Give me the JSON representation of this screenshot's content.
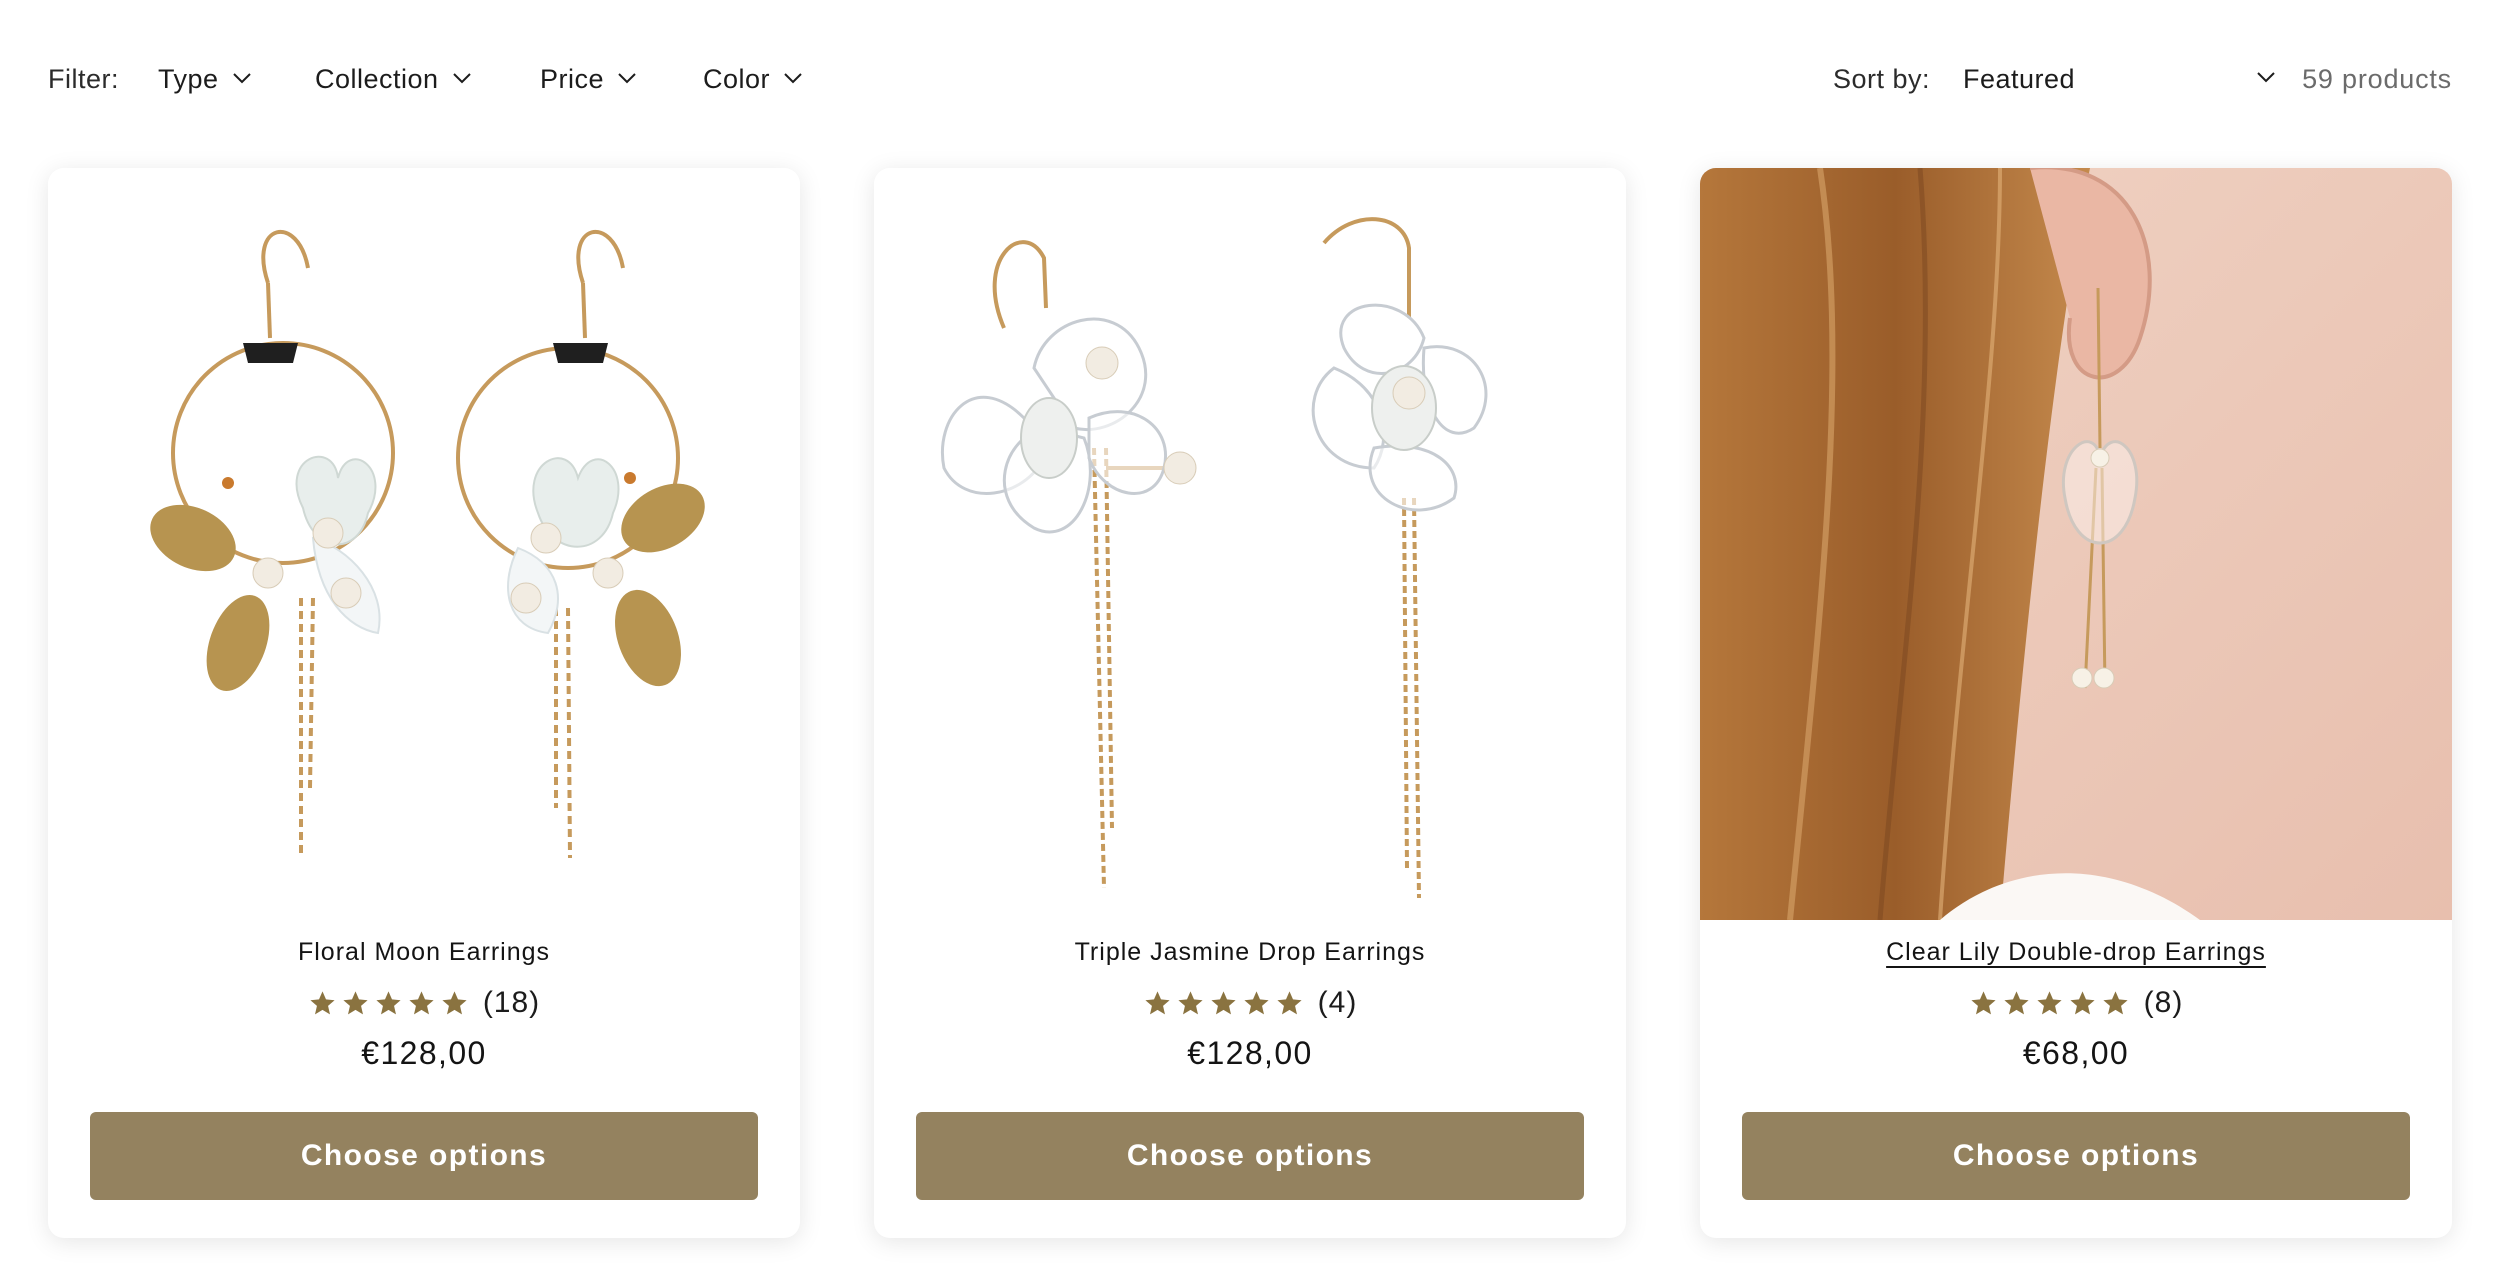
{
  "filter": {
    "label": "Filter:",
    "facets": [
      {
        "label": "Type"
      },
      {
        "label": "Collection"
      },
      {
        "label": "Price"
      },
      {
        "label": "Color"
      }
    ]
  },
  "sort": {
    "label": "Sort by:",
    "selected": "Featured"
  },
  "product_count": "59 products",
  "colors": {
    "accent": "#94825f",
    "star": "#8a7340"
  },
  "products": [
    {
      "title": "Floral Moon Earrings",
      "rating": 5,
      "review_count": "(18)",
      "price": "€128,00",
      "button_label": "Choose options",
      "image_icon": "floral-moon-earrings-image"
    },
    {
      "title": "Triple Jasmine Drop Earrings",
      "rating": 5,
      "review_count": "(4)",
      "price": "€128,00",
      "button_label": "Choose options",
      "image_icon": "triple-jasmine-drop-earrings-image"
    },
    {
      "title": "Clear Lily Double-drop Earrings",
      "rating": 5,
      "review_count": "(8)",
      "price": "€68,00",
      "button_label": "Choose options",
      "image_icon": "model-wearing-earring-image"
    }
  ]
}
